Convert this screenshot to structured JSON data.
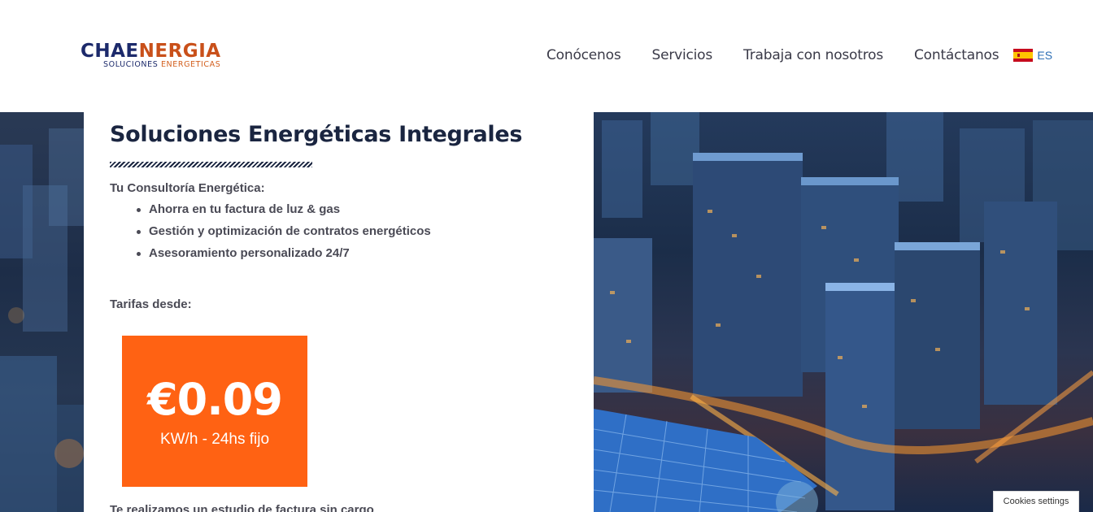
{
  "header": {
    "logo": {
      "main_part1": "CHAE",
      "main_part2": "NERGIA",
      "sub_part1": "SOLUCIONES ",
      "sub_part2": "ENERGETICAS"
    },
    "nav": [
      {
        "label": "Conócenos"
      },
      {
        "label": "Servicios"
      },
      {
        "label": "Trabaja con nosotros"
      },
      {
        "label": "Contáctanos"
      }
    ],
    "language": {
      "code": "ES",
      "flag_icon": "spain-flag-icon"
    }
  },
  "main": {
    "title": "Soluciones Energéticas Integrales",
    "subtitle": "Tu Consultoría Energética:",
    "bullets": [
      "Ahorra en tu factura de luz & gas",
      "Gestión y optimización de contratos energéticos",
      "Asesoramiento personalizado 24/7"
    ],
    "rates_label": "Tarifas desde:",
    "price": {
      "value": "€0.09",
      "unit": "KW/h - 24hs fijo"
    },
    "footnote": "Te realizamos un estudio de factura sin cargo"
  },
  "cookies_button": "Cookies settings",
  "colors": {
    "brand_navy": "#1c2a6b",
    "brand_orange": "#c9501a",
    "price_box": "#ff6213",
    "title": "#1a2540",
    "nav_text": "#3a3a48",
    "lang_link": "#2d6fb5"
  }
}
